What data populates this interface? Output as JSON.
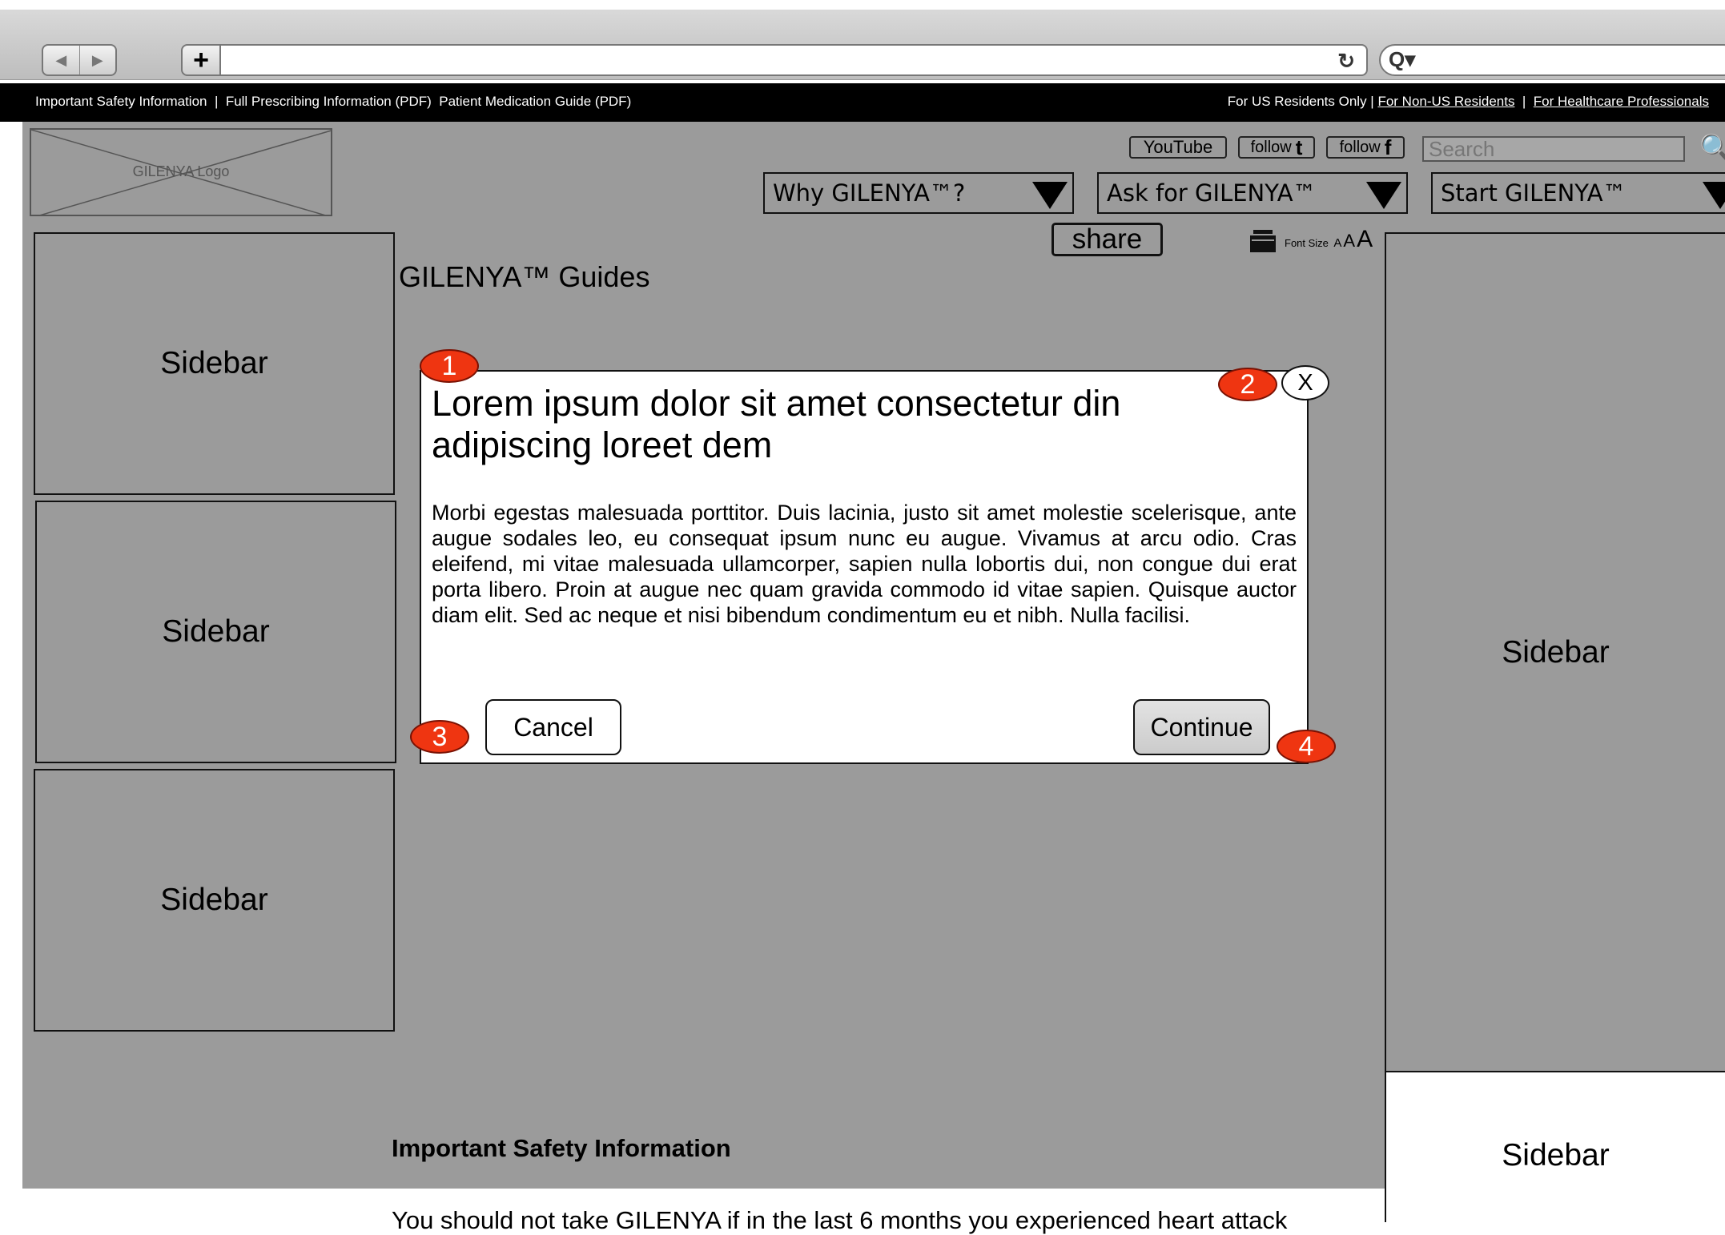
{
  "browser": {
    "back_glyph": "◀",
    "forward_glyph": "▶",
    "new_tab_glyph": "+",
    "reload_glyph": "↻",
    "search_glyph": "Q▾"
  },
  "utility_bar": {
    "important_safety": "Important Safety Information",
    "sep1": "  |  ",
    "full_prescribing": "Full Prescribing Information (PDF)",
    "sep2": "  ",
    "med_guide": "Patient Medication Guide (PDF)",
    "us_only": "For US Residents Only | ",
    "non_us": "For Non-US Residents",
    "sep3": "  |  ",
    "hcp": "For Healthcare Professionals"
  },
  "header": {
    "logo_text": "GILENYA Logo",
    "youtube": "YouTube",
    "follow_twitter_word": "follow",
    "follow_twitter_letter": "t",
    "follow_facebook_word": "follow",
    "follow_facebook_letter": "f",
    "search_placeholder": "Search",
    "search_icon": "🔍"
  },
  "nav": {
    "items": [
      {
        "label": "Why GILENYA™?"
      },
      {
        "label": "Ask for GILENYA™"
      },
      {
        "label": "Start GILENYA™"
      }
    ]
  },
  "tools": {
    "share": "share",
    "font_size_label": "Font Size",
    "a_small": "A",
    "a_medium": "A",
    "a_large": "A"
  },
  "page": {
    "title": "GILENYA™ Guides",
    "isi_heading": "Important Safety Information",
    "isi_text": "You should not take GILENYA if in the last 6 months you experienced heart attack"
  },
  "sidebars": {
    "left_1": "Sidebar",
    "left_2": "Sidebar",
    "left_3": "Sidebar",
    "right_1": "Sidebar",
    "right_2": "Sidebar"
  },
  "modal": {
    "title": "Lorem ipsum dolor sit amet consectetur din adipiscing loreet dem",
    "body": "Morbi egestas malesuada porttitor. Duis lacinia, justo sit amet molestie scelerisque, ante augue sodales leo, eu consequat ipsum nunc eu augue. Vivamus at arcu odio. Cras eleifend, mi vitae malesuada ullamcorper, sapien nulla lobortis dui, non congue dui erat porta libero. Proin at augue nec quam gravida commodo id vitae sapien. Quisque auctor diam elit. Sed ac neque et nisi bibendum condimentum eu et nibh. Nulla facilisi.",
    "cancel": "Cancel",
    "continue": "Continue",
    "close": "X"
  },
  "callouts": {
    "c1": "1",
    "c2": "2",
    "c3": "3",
    "c4": "4"
  },
  "colors": {
    "page_gray": "#9b9b9b",
    "callout_red": "#ef3511",
    "utility_bar_bg": "#000000"
  }
}
